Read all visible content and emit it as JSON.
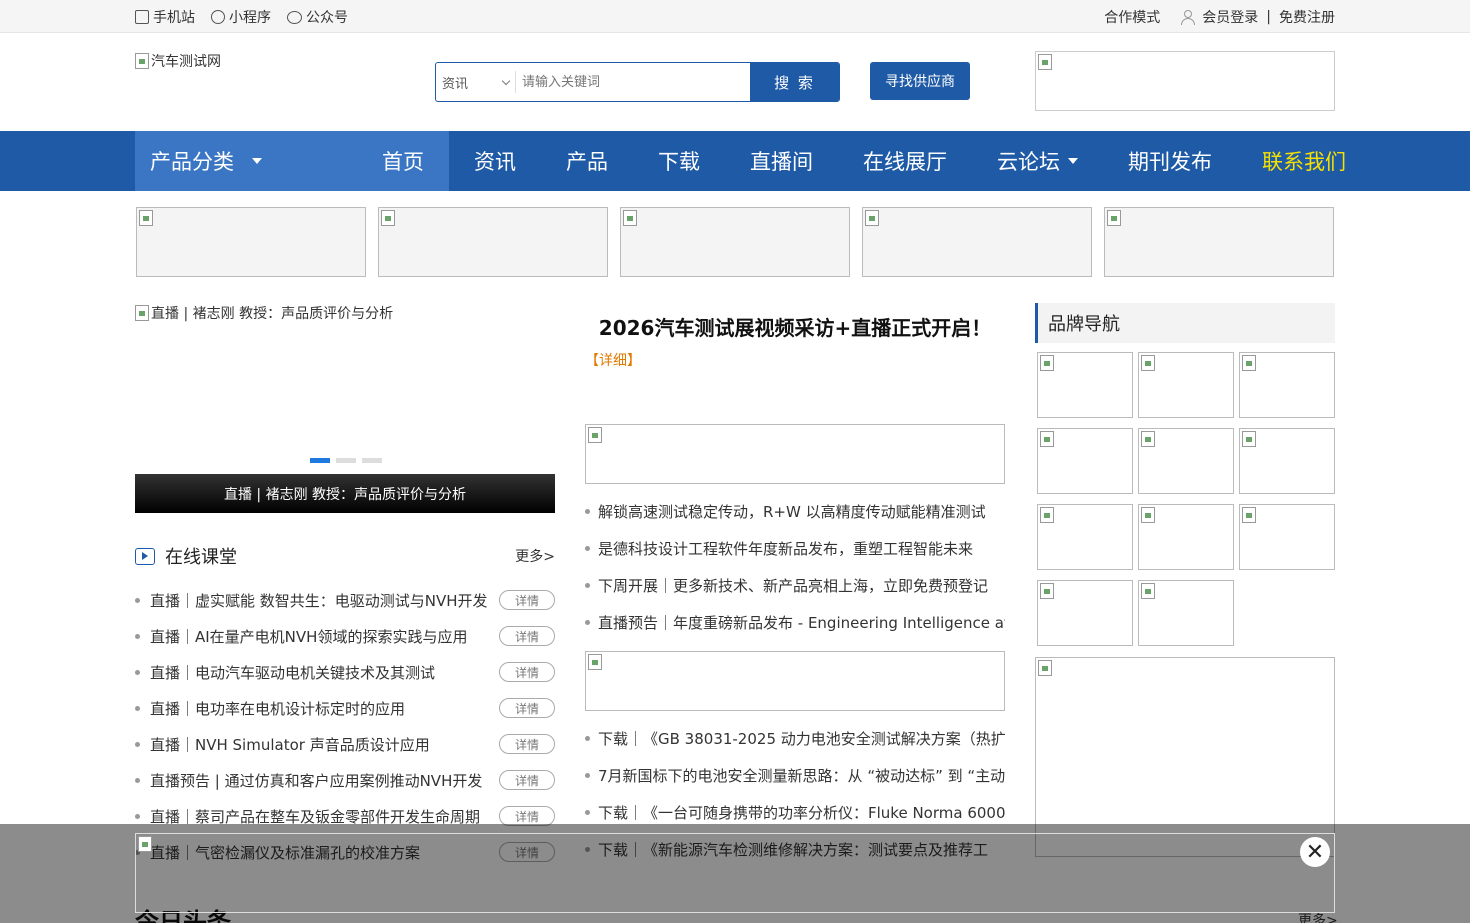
{
  "topbar": {
    "mobile": "手机站",
    "miniprogram": "小程序",
    "official": "公众号",
    "cooperation": "合作模式",
    "login": "会员登录",
    "separator": "|",
    "register": "免费注册"
  },
  "header": {
    "logo_alt": "汽车测试网",
    "search_category": "资讯",
    "search_placeholder": "请输入关键词",
    "search_button": "搜 索",
    "supplier_button": "寻找供应商"
  },
  "nav": {
    "category": "产品分类",
    "items": [
      "首页",
      "资讯",
      "产品",
      "下载",
      "直播间",
      "在线展厅",
      "云论坛",
      "期刊发布",
      "联系我们"
    ]
  },
  "slide": {
    "alt": "直播 | 褚志刚 教授：声品质评价与分析",
    "caption": "直播 | 褚志刚 教授：声品质评价与分析"
  },
  "courses": {
    "title": "在线课堂",
    "more": "更多>",
    "tag": "详情",
    "items": [
      "直播｜虚实赋能 数智共生：电驱动测试与NVH开发",
      "直播｜AI在量产电机NVH领域的探索实践与应用",
      "直播｜电动汽车驱动电机关键技术及其测试",
      "直播｜电功率在电机设计标定时的应用",
      "直播｜NVH Simulator 声音品质设计应用",
      "直播预告 | 通过仿真和客户应用案例推动NVH开发",
      "直播｜蔡司产品在整车及钣金零部件开发生命周期",
      "直播｜气密检漏仪及标准漏孔的校准方案"
    ]
  },
  "middle": {
    "headline": "2026汽车测试展视频采访+直播正式开启！",
    "detail": "【详细】",
    "news1": [
      "解锁高速测试稳定传动，R+W 以高精度传动赋能精准测试",
      "是德科技设计工程软件年度新品发布，重塑工程智能未来",
      "下周开展｜更多新技术、新产品亮相上海，立即免费预登记",
      "直播预告｜年度重磅新品发布 - Engineering Intelligence at th"
    ],
    "news2": [
      "下载｜《GB 38031-2025 动力电池安全测试解决方案（热扩",
      "7月新国标下的电池安全测量新思路：从 “被动达标” 到 “主动",
      "下载｜《一台可随身携带的功率分析仪：Fluke Norma 6000",
      "下载｜《新能源汽车检测维修解决方案：测试要点及推荐工"
    ]
  },
  "brand": {
    "title": "品牌导航"
  },
  "bottom": {
    "title": "今日头条",
    "more": "更多>"
  },
  "overlay": {
    "close": "✕"
  }
}
